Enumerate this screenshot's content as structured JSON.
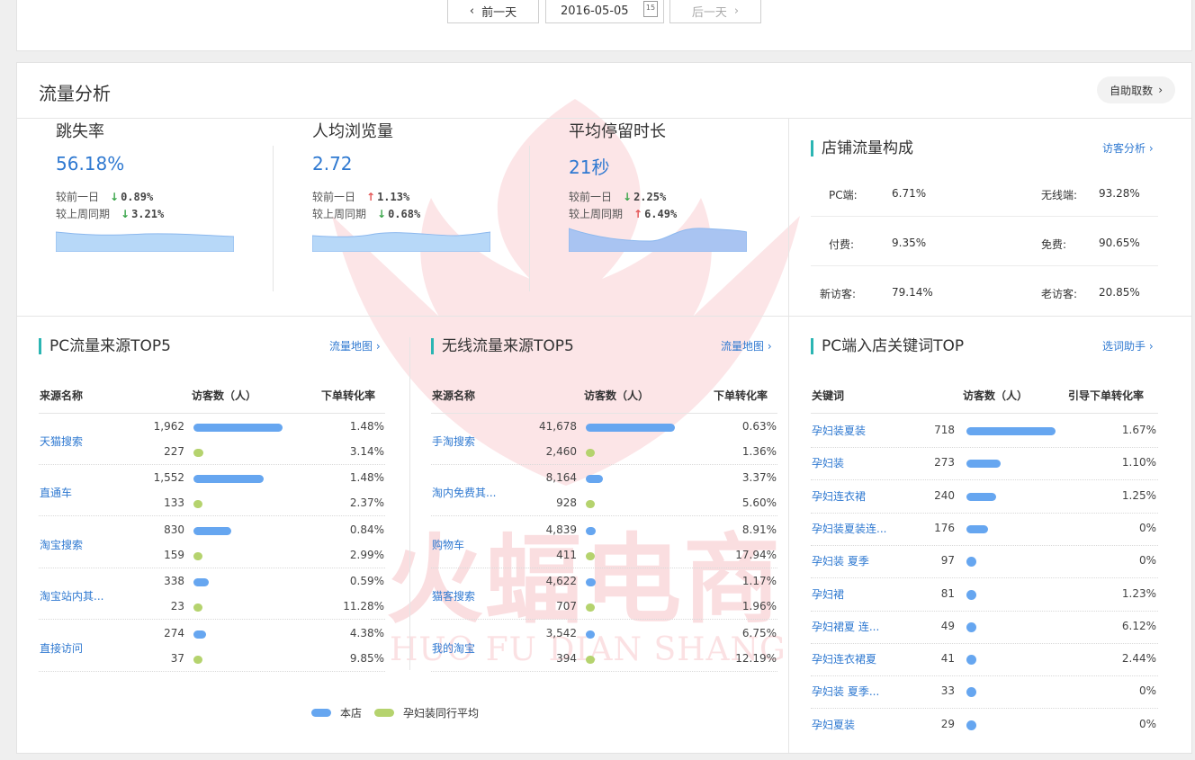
{
  "topnav": {
    "prev_label": "前一天",
    "date": "2016-05-05",
    "cal_day": "15",
    "next_label": "后一天"
  },
  "panel": {
    "title": "流量分析",
    "self_fetch_label": "自助取数"
  },
  "metrics": [
    {
      "name": "跳失率",
      "value": "56.18%",
      "day_label": "较前一日",
      "day_dir": "down",
      "day_val": "0.89%",
      "week_label": "较上周同期",
      "week_dir": "down",
      "week_val": "3.21%"
    },
    {
      "name": "人均浏览量",
      "value": "2.72",
      "day_label": "较前一日",
      "day_dir": "up",
      "day_val": "1.13%",
      "week_label": "较上周同期",
      "week_dir": "down",
      "week_val": "0.68%"
    },
    {
      "name": "平均停留时长",
      "value": "21秒",
      "day_label": "较前一日",
      "day_dir": "down",
      "day_val": "2.25%",
      "week_label": "较上周同期",
      "week_dir": "up",
      "week_val": "6.49%"
    }
  ],
  "composition": {
    "title": "店铺流量构成",
    "link": "访客分析",
    "rows": [
      {
        "l1": "PC端:",
        "v1": "6.71%",
        "l2": "无线端:",
        "v2": "93.28%"
      },
      {
        "l1": "付费:",
        "v1": "9.35%",
        "l2": "免费:",
        "v2": "90.65%"
      },
      {
        "l1": "新访客:",
        "v1": "79.14%",
        "l2": "老访客:",
        "v2": "20.85%"
      }
    ]
  },
  "pc_sources": {
    "title": "PC流量来源TOP5",
    "link": "流量地图",
    "headers": [
      "来源名称",
      "访客数（人）",
      "下单转化率"
    ],
    "rows": [
      {
        "name": "天猫搜索",
        "v1": "1,962",
        "v1n": 1962,
        "p1": "1.48%",
        "v2": "227",
        "v2n": 227,
        "p2": "3.14%"
      },
      {
        "name": "直通车",
        "v1": "1,552",
        "v1n": 1552,
        "p1": "1.48%",
        "v2": "133",
        "v2n": 133,
        "p2": "2.37%"
      },
      {
        "name": "淘宝搜索",
        "v1": "830",
        "v1n": 830,
        "p1": "0.84%",
        "v2": "159",
        "v2n": 159,
        "p2": "2.99%"
      },
      {
        "name": "淘宝站内其...",
        "v1": "338",
        "v1n": 338,
        "p1": "0.59%",
        "v2": "23",
        "v2n": 23,
        "p2": "11.28%"
      },
      {
        "name": "直接访问",
        "v1": "274",
        "v1n": 274,
        "p1": "4.38%",
        "v2": "37",
        "v2n": 37,
        "p2": "9.85%"
      }
    ]
  },
  "mobile_sources": {
    "title": "无线流量来源TOP5",
    "link": "流量地图",
    "headers": [
      "来源名称",
      "访客数（人）",
      "下单转化率"
    ],
    "rows": [
      {
        "name": "手淘搜索",
        "v1": "41,678",
        "v1n": 41678,
        "p1": "0.63%",
        "v2": "2,460",
        "v2n": 2460,
        "p2": "1.36%"
      },
      {
        "name": "淘内免费其...",
        "v1": "8,164",
        "v1n": 8164,
        "p1": "3.37%",
        "v2": "928",
        "v2n": 928,
        "p2": "5.60%"
      },
      {
        "name": "购物车",
        "v1": "4,839",
        "v1n": 4839,
        "p1": "8.91%",
        "v2": "411",
        "v2n": 411,
        "p2": "17.94%"
      },
      {
        "name": "猫客搜索",
        "v1": "4,622",
        "v1n": 4622,
        "p1": "1.17%",
        "v2": "707",
        "v2n": 707,
        "p2": "1.96%"
      },
      {
        "name": "我的淘宝",
        "v1": "3,542",
        "v1n": 3542,
        "p1": "6.75%",
        "v2": "394",
        "v2n": 394,
        "p2": "12.19%"
      }
    ]
  },
  "legend": {
    "own": "本店",
    "peer": "孕妇装同行平均"
  },
  "keywords": {
    "title": "PC端入店关键词TOP",
    "link": "选词助手",
    "headers": [
      "关键词",
      "访客数（人）",
      "引导下单转化率"
    ],
    "rows": [
      {
        "kw": "孕妇装夏装",
        "v": "718",
        "vn": 718,
        "p": "1.67%"
      },
      {
        "kw": "孕妇装",
        "v": "273",
        "vn": 273,
        "p": "1.10%"
      },
      {
        "kw": "孕妇连衣裙",
        "v": "240",
        "vn": 240,
        "p": "1.25%"
      },
      {
        "kw": "孕妇装夏装连...",
        "v": "176",
        "vn": 176,
        "p": "0%"
      },
      {
        "kw": "孕妇装 夏季",
        "v": "97",
        "vn": 97,
        "p": "0%"
      },
      {
        "kw": "孕妇裙",
        "v": "81",
        "vn": 81,
        "p": "1.23%"
      },
      {
        "kw": "孕妇裙夏 连...",
        "v": "49",
        "vn": 49,
        "p": "6.12%"
      },
      {
        "kw": "孕妇连衣裙夏",
        "v": "41",
        "vn": 41,
        "p": "2.44%"
      },
      {
        "kw": "孕妇装 夏季...",
        "v": "33",
        "vn": 33,
        "p": "0%"
      },
      {
        "kw": "孕妇夏装",
        "v": "29",
        "vn": 29,
        "p": "0%"
      }
    ]
  },
  "watermark": {
    "text_cn": "火蝠电商",
    "text_en": "HUO FU DIAN SHANG"
  },
  "colors": {
    "accent": "#2f79d1",
    "own_bar": "#66a6f0",
    "peer_bar": "#b5d36e",
    "up": "#e45454",
    "down": "#3aa54a",
    "title_mark": "#2bb5b3"
  }
}
